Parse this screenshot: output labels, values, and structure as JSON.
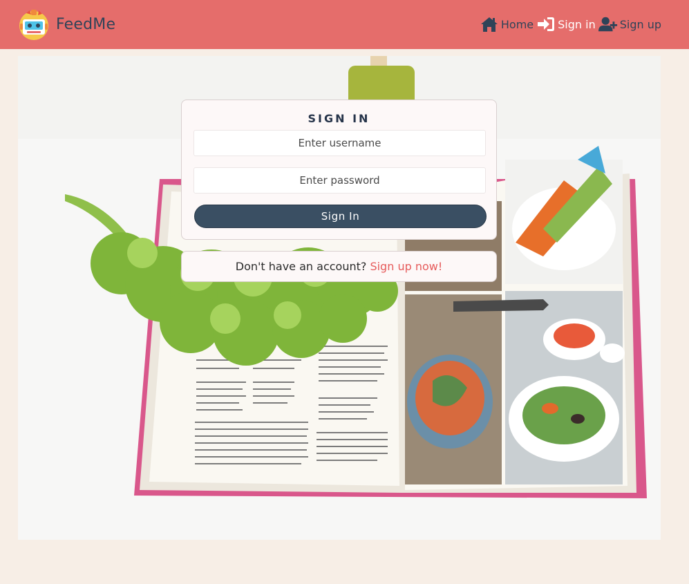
{
  "brand": {
    "name": "FeedMe",
    "logo_icon": "robot-chef-logo"
  },
  "nav": {
    "home_label": "Home",
    "signin_label": "Sign in",
    "signup_label": "Sign up"
  },
  "signin_form": {
    "title": "SIGN IN",
    "username_placeholder": "Enter username",
    "password_placeholder": "Enter password",
    "submit_label": "Sign In"
  },
  "signup_prompt": {
    "text": "Don't have an account? ",
    "link_label": "Sign up now!"
  },
  "hero": {
    "image_subject": "open-cookbook-with-lettuce"
  },
  "colors": {
    "navbar": "#e56d6b",
    "page_background": "#f7eee6",
    "primary_button": "#3a4f63",
    "link": "#e65b5b",
    "text_dark": "#2f4358"
  }
}
